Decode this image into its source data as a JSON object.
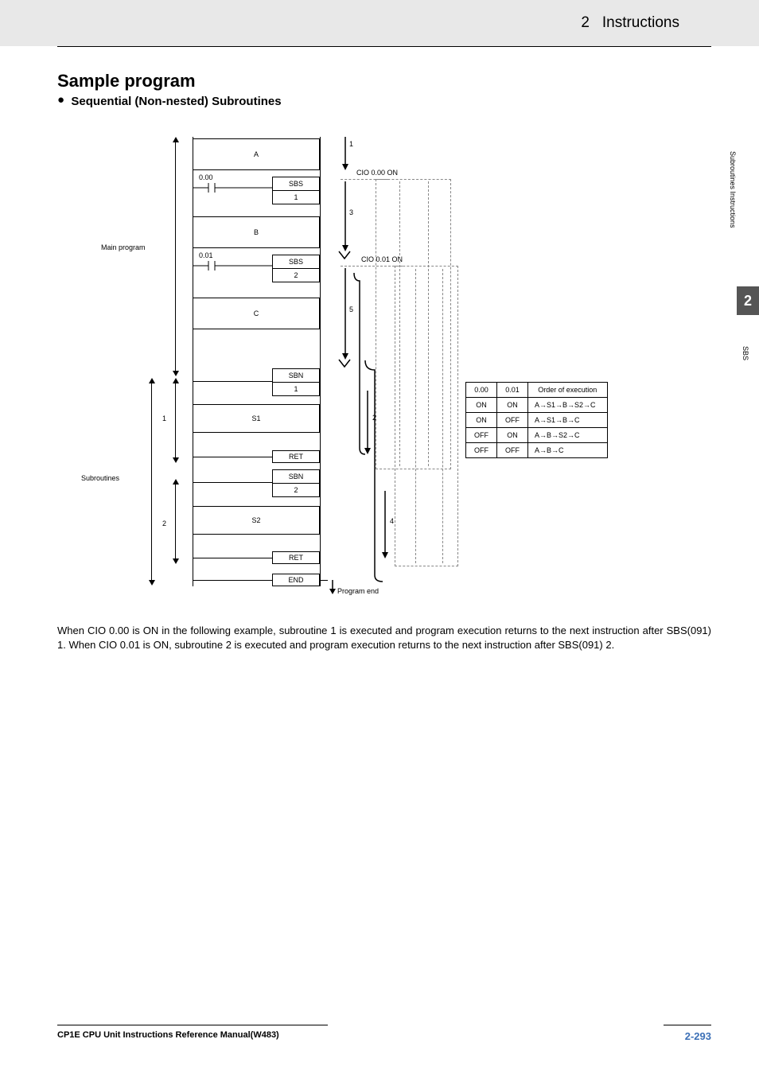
{
  "header": {
    "chapter": "2",
    "title": "Instructions"
  },
  "sidebar": {
    "tab_number": "2",
    "section_label": "Subroutines Instructions",
    "topic": "SBS"
  },
  "section": {
    "title": "Sample program",
    "subtitle": "Sequential (Non-nested) Subroutines"
  },
  "diagram": {
    "main_program_label": "Main program",
    "subroutines_label": "Subroutines",
    "block_a": "A",
    "block_b": "B",
    "block_c": "C",
    "block_s1": "S1",
    "block_s2": "S2",
    "contact_000": "0.00",
    "contact_001": "0.01",
    "instr_sbs": "SBS",
    "instr_sbn": "SBN",
    "instr_ret": "RET",
    "instr_end": "END",
    "num_1": "1",
    "num_2": "2",
    "cio_000_on": "CIO  0.00 ON",
    "cio_001_on": "CIO  0.01 ON",
    "flow_1": "1",
    "flow_2": "2",
    "flow_3": "3",
    "flow_4": "4",
    "flow_5": "5",
    "program_end": "Program end",
    "sub_num_1": "1",
    "sub_num_2": "2"
  },
  "table": {
    "h1": "0.00",
    "h2": "0.01",
    "h3": "Order of execution",
    "rows": [
      {
        "c1": "ON",
        "c2": "ON",
        "exec": "A→S1→B→S2→C"
      },
      {
        "c1": "ON",
        "c2": "OFF",
        "exec": "A→S1→B→C"
      },
      {
        "c1": "OFF",
        "c2": "ON",
        "exec": "A→B→S2→C"
      },
      {
        "c1": "OFF",
        "c2": "OFF",
        "exec": "A→B→C"
      }
    ]
  },
  "explanation": "When CIO  0.00 is ON in the following example, subroutine 1 is executed and program execution returns to the next instruction after SBS(091) 1. When CIO  0.01 is ON, subroutine 2 is executed and program execution returns to the next instruction after SBS(091) 2.",
  "footer": {
    "manual": "CP1E CPU Unit Instructions Reference Manual(W483)",
    "page": "2-293"
  }
}
